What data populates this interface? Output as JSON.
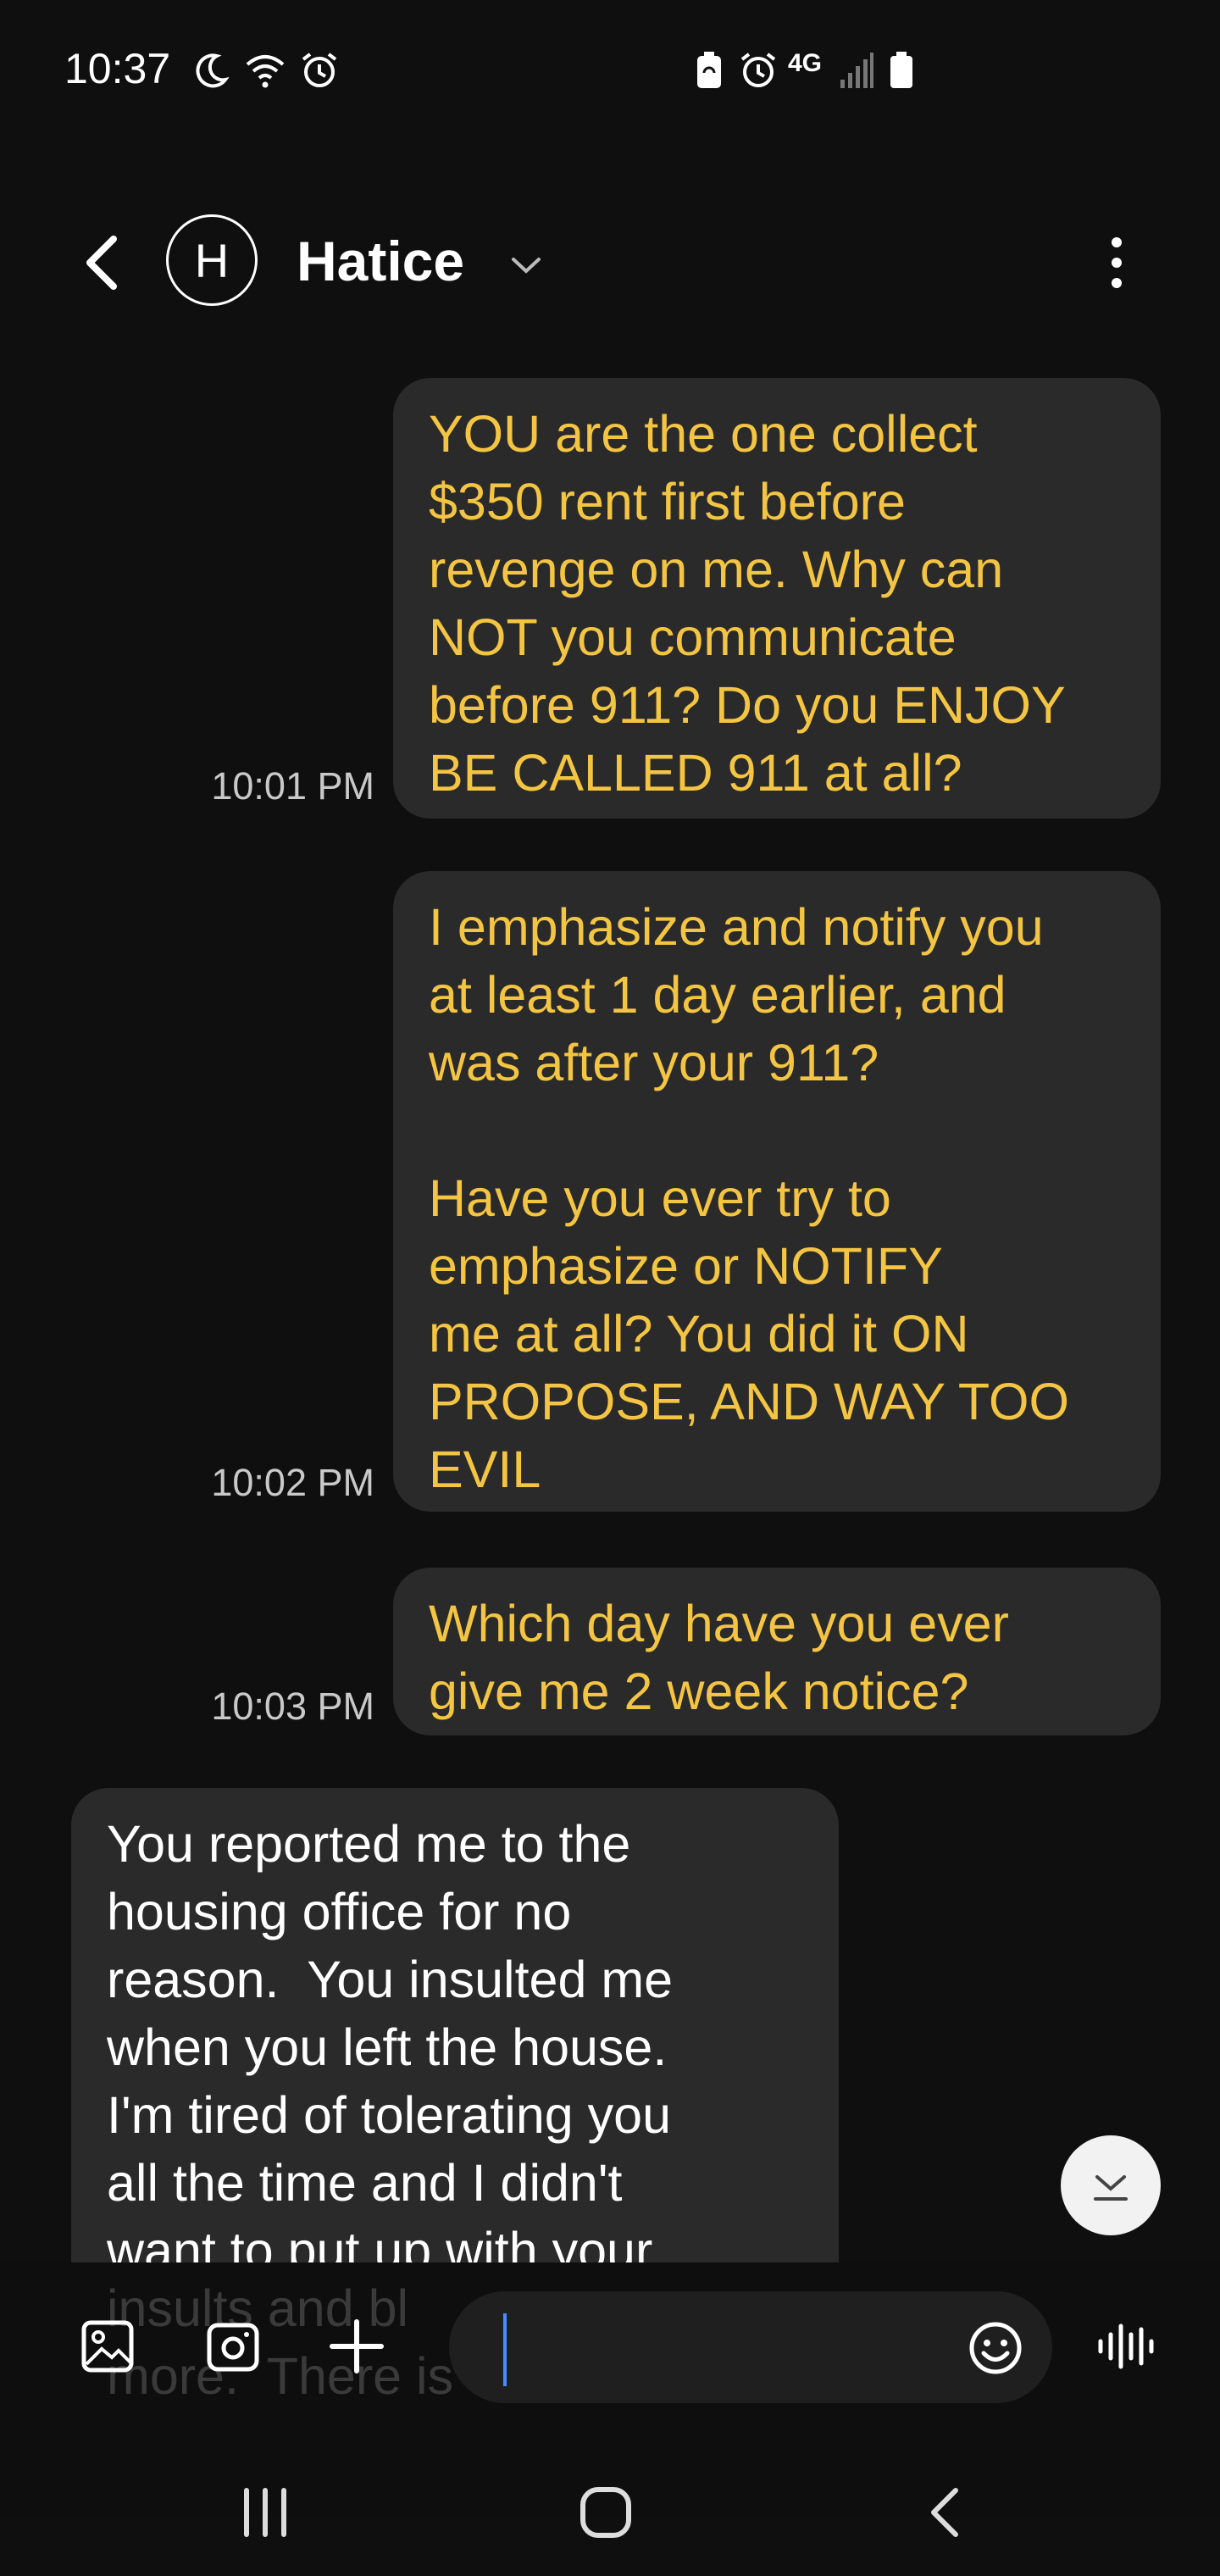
{
  "status_bar": {
    "time": "10:37",
    "left_icons": [
      "moon-icon",
      "wifi-icon",
      "alarm-icon"
    ],
    "right_icons": [
      "battery-saver-icon",
      "alarm-icon",
      "4g-icon",
      "signal-icon",
      "battery-icon"
    ],
    "network_label": "4G"
  },
  "header": {
    "avatar_letter": "H",
    "contact_name": "Hatice"
  },
  "messages": [
    {
      "direction": "sent",
      "time": "10:01 PM",
      "text": "YOU are the one collect\n$350 rent first before\nrevenge on me. Why can\nNOT you communicate\nbefore 911? Do you ENJOY\nBE CALLED 911 at all?"
    },
    {
      "direction": "sent",
      "time": "10:02 PM",
      "text": "I emphasize and notify you\nat least 1 day earlier, and\nwas after your 911?\n\nHave you ever try to\nemphasize or NOTIFY\nme at all? You did it ON\nPROPOSE, AND WAY TOO\nEVIL"
    },
    {
      "direction": "sent",
      "time": "10:03 PM",
      "text": "Which day have you ever\ngive me 2 week notice?"
    },
    {
      "direction": "received",
      "text": "You reported me to the\nhousing office for no\nreason.  You insulted me\nwhen you left the house.\nI'm tired of tolerating you\nall the time and I didn't\nwant to put up with your"
    }
  ],
  "ghost_text": "insults and bl\nmore.  There is",
  "composer": {
    "placeholder": ""
  },
  "colors": {
    "background": "#0f0f0f",
    "bubble": "#2a2a2a",
    "sent_text": "#f4c542",
    "cursor": "#4a8cff"
  }
}
